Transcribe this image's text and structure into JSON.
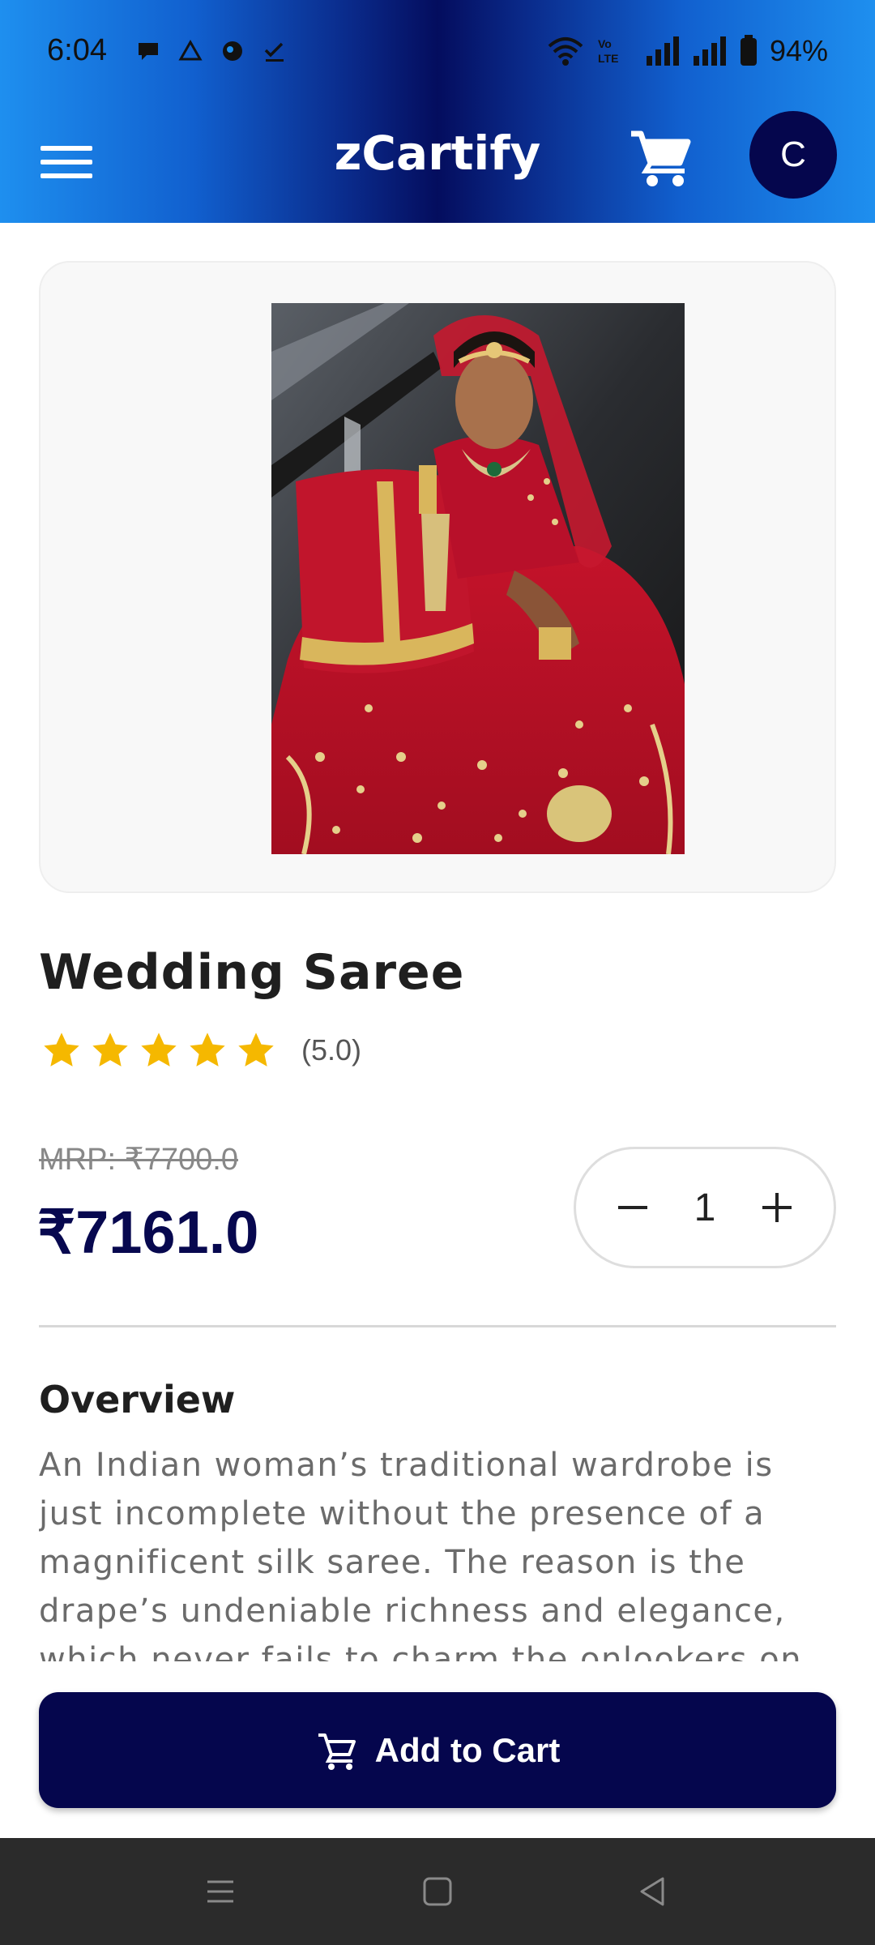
{
  "status_bar": {
    "time": "6:04",
    "battery": "94%",
    "icons_left": [
      "chat-icon",
      "drive-icon",
      "vpn-icon",
      "task-check-icon"
    ],
    "icons_right": [
      "wifi-icon",
      "volte-icon",
      "signal-icon",
      "signal-icon",
      "battery-icon"
    ]
  },
  "header": {
    "title": "zCartify",
    "avatar_initial": "C",
    "menu_icon": "hamburger-menu-icon",
    "cart_icon": "shopping-cart-icon"
  },
  "product": {
    "title": "Wedding Saree",
    "rating_text": "(5.0)",
    "rating_value": 5.0,
    "stars": 5,
    "mrp": "MRP: ₹7700.0",
    "price": "₹7161.0",
    "quantity": "1",
    "image_alt": "Bride in red bridal saree with gold jewellery"
  },
  "overview": {
    "heading": "Overview",
    "text": "An Indian woman’s traditional wardrobe is just incomplete without the presence of a magnificent silk saree. The reason is the drape’s undeniable richness and elegance, which never fails to charm the onlookers on"
  },
  "actions": {
    "add_to_cart": "Add to Cart"
  },
  "colors": {
    "accent_dark": "#05064d",
    "header_blue": "#1e8fef",
    "star": "#f5b800"
  }
}
